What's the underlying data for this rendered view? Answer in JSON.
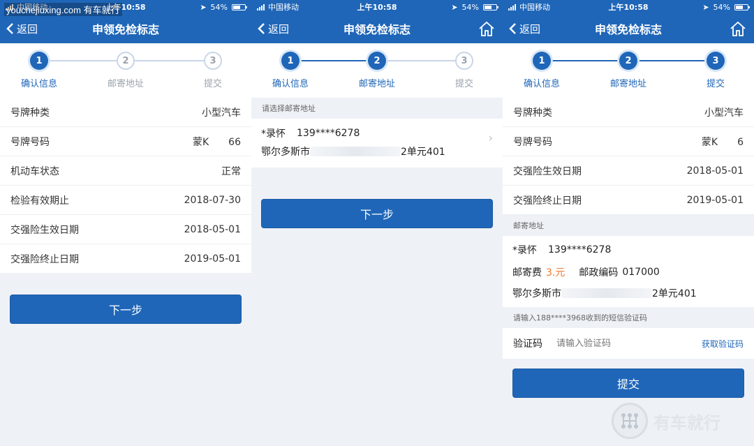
{
  "watermark": {
    "site": "youchejiuxing.com",
    "brand": "有车就行",
    "logo_text": "有车就行"
  },
  "colors": {
    "primary": "#1f66b8",
    "fee": "#e87a30"
  },
  "status_bar": {
    "carrier": "中国移动",
    "time": "上午10:58",
    "battery": "54%"
  },
  "nav": {
    "back_label": "返回",
    "title": "申领免检标志"
  },
  "steps": [
    "确认信息",
    "邮寄地址",
    "提交"
  ],
  "screen1": {
    "rows": [
      {
        "k": "号牌种类",
        "v": "小型汽车"
      },
      {
        "k": "号牌号码",
        "v": "蒙K　　66"
      },
      {
        "k": "机动车状态",
        "v": "正常"
      },
      {
        "k": "检验有效期止",
        "v": "2018-07-30"
      },
      {
        "k": "交强险生效日期",
        "v": "2018-05-01"
      },
      {
        "k": "交强险终止日期",
        "v": "2019-05-01"
      }
    ],
    "button": "下一步"
  },
  "screen2": {
    "section": "请选择邮寄地址",
    "name": "*录怀",
    "phone": "139****6278",
    "address_start": "鄂尔多斯市",
    "address_end": "2单元401",
    "button": "下一步"
  },
  "screen3": {
    "rows": [
      {
        "k": "号牌种类",
        "v": "小型汽车"
      },
      {
        "k": "号牌号码",
        "v": "蒙K　　6"
      },
      {
        "k": "交强险生效日期",
        "v": "2018-05-01"
      },
      {
        "k": "交强险终止日期",
        "v": "2019-05-01"
      }
    ],
    "mail_section": "邮寄地址",
    "name": "*录怀",
    "phone": "139****6278",
    "fee_label": "邮寄费",
    "fee_value": "3.元",
    "postcode_label": "邮政编码",
    "postcode": "017000",
    "address_start": "鄂尔多斯市",
    "address_end": "2单元401",
    "sms_hint": "请输入188****3968收到的短信验证码",
    "code_label": "验证码",
    "code_placeholder": "请输入验证码",
    "get_code": "获取验证码",
    "button": "提交"
  }
}
